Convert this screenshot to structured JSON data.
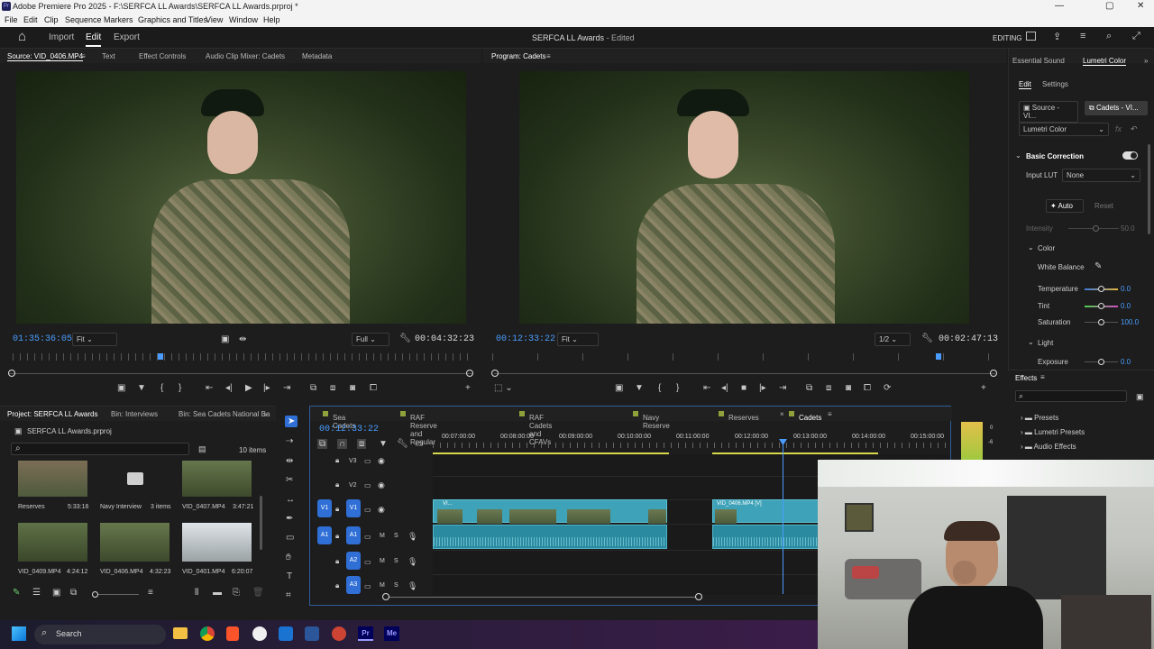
{
  "window": {
    "title": "Adobe Premiere Pro 2025 - F:\\SERFCA LL Awards\\SERFCA LL Awards.prproj *",
    "controls": [
      "—",
      "▢",
      "✕"
    ]
  },
  "menu": [
    "File",
    "Edit",
    "Clip",
    "Sequence",
    "Markers",
    "Graphics and Titles",
    "View",
    "Window",
    "Help"
  ],
  "appbar": {
    "home": "⌂",
    "tabs": [
      "Import",
      "Edit",
      "Export"
    ],
    "active": "Edit",
    "project_title": "SERFCA LL Awards",
    "status": "- Edited",
    "workspace": "EDITING"
  },
  "source": {
    "tabs": [
      "Source: VID_0406.MP4",
      "Text",
      "Effect Controls",
      "Audio Clip Mixer: Cadets",
      "Metadata"
    ],
    "timecode": "01:35:36:05",
    "fit": "Fit",
    "quality": "Full",
    "duration": "00:04:32:23"
  },
  "program": {
    "tab": "Program: Cadets",
    "timecode": "00:12:33:22",
    "fit": "Fit",
    "quality": "1/2",
    "duration": "00:02:47:13"
  },
  "right": {
    "tabs": [
      "Essential Sound",
      "Lumetri Color"
    ],
    "subtabs": [
      "Edit",
      "Settings"
    ],
    "source_btn": "Source - VI...",
    "seq_btn": "Cadets - VI...",
    "effect": "Lumetri Color",
    "section": "Basic Correction",
    "input_lut_label": "Input LUT",
    "input_lut": "None",
    "auto": "Auto",
    "reset": "Reset",
    "intensity_label": "Intensity",
    "intensity": "50.0",
    "color": "Color",
    "white_balance": "White Balance",
    "temperature_label": "Temperature",
    "temperature": "0.0",
    "tint_label": "Tint",
    "tint": "0.0",
    "saturation_label": "Saturation",
    "saturation": "100.0",
    "light": "Light",
    "exposure_label": "Exposure",
    "exposure": "0.0"
  },
  "effects": {
    "title": "Effects",
    "items": [
      "Presets",
      "Lumetri Presets",
      "Audio Effects"
    ]
  },
  "project": {
    "tabs": [
      "Project: SERFCA LL Awards",
      "Bin: Interviews",
      "Bin: Sea Cadets National Ba"
    ],
    "file": "SERFCA LL Awards.prproj",
    "count": "10 items",
    "items": [
      {
        "name": "Reserves",
        "meta": "5:33:16"
      },
      {
        "name": "Navy Interview",
        "meta": "3 items"
      },
      {
        "name": "VID_0407.MP4",
        "meta": "3:47:21"
      },
      {
        "name": "VID_0409.MP4",
        "meta": "4:24:12"
      },
      {
        "name": "VID_0406.MP4",
        "meta": "4:32:23"
      },
      {
        "name": "VID_0401.MP4",
        "meta": "6:20:07"
      }
    ]
  },
  "timeline": {
    "tabs": [
      "Sea Cadets",
      "RAF Reserve and Regular",
      "RAF Cadets and CFAVs",
      "Navy Reserve",
      "Reserves",
      "Cadets"
    ],
    "active": "Cadets",
    "timecode": "00:12:33:22",
    "ruler": [
      "00:07:00:00",
      "00:08:00:00",
      "00:09:00:00",
      "00:10:00:00",
      "00:11:00:00",
      "00:12:00:00",
      "00:13:00:00",
      "00:14:00:00",
      "00:15:00:00"
    ],
    "tracks": [
      "V3",
      "V2",
      "V1",
      "A1",
      "A2",
      "A3"
    ],
    "clip1": "VI...",
    "clip2": "VID_0406.MP4 [V]"
  },
  "meter": [
    "0",
    "-6"
  ],
  "taskbar": {
    "search": "Search"
  }
}
